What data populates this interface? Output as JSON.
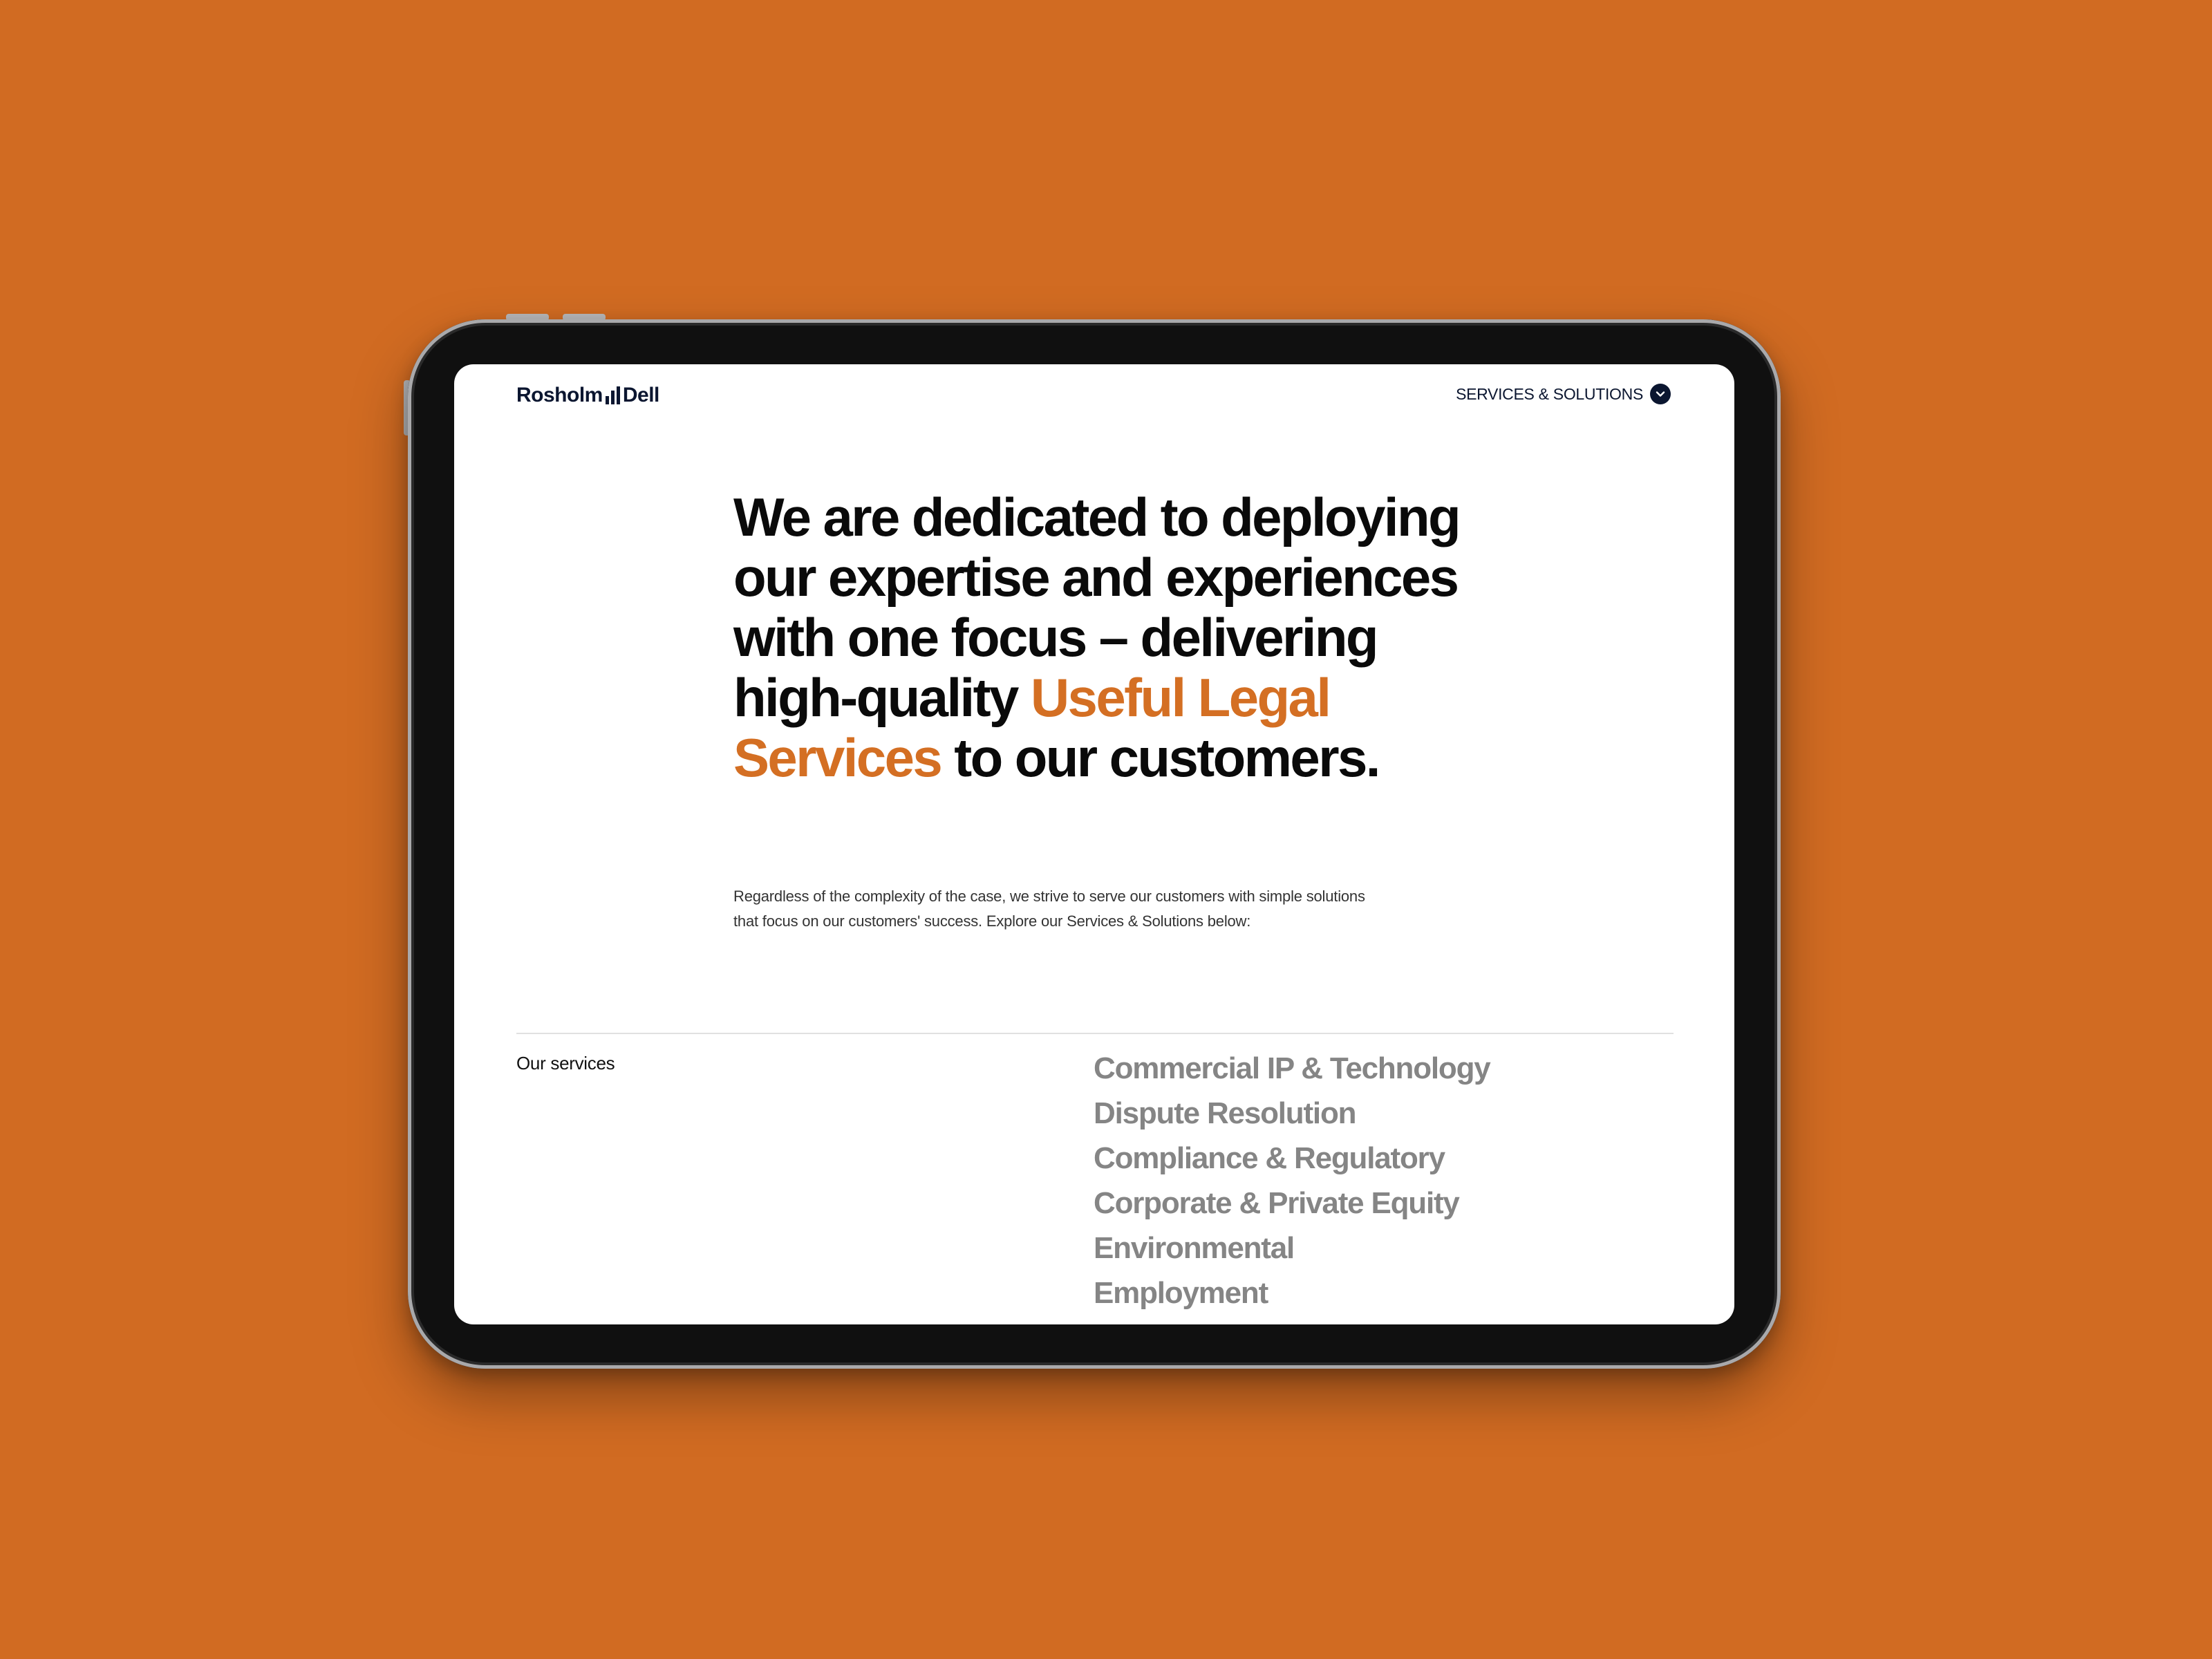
{
  "colors": {
    "background": "#d16b22",
    "accent": "#d46f23",
    "navy": "#0b1630",
    "service_text": "#858585"
  },
  "header": {
    "logo_left": "Rosholm",
    "logo_right": "Dell",
    "nav_label": "SERVICES & SOLUTIONS",
    "nav_icon": "chevron-down-icon"
  },
  "hero": {
    "text_before": "We are dedicated to deploying our expertise and experiences with one focus – delivering high-quality ",
    "highlight": "Useful Legal Services",
    "text_after": " to our customers."
  },
  "intro": {
    "line1": "Regardless of the complexity of the case, we strive to serve our customers with simple solutions",
    "line2": "that focus on our customers' success. Explore our Services & Solutions below:"
  },
  "services": {
    "heading": "Our services",
    "items": [
      "Commercial IP & Technology",
      "Dispute Resolution",
      "Compliance & Regulatory",
      "Corporate & Private Equity",
      "Environmental",
      "Employment"
    ]
  }
}
